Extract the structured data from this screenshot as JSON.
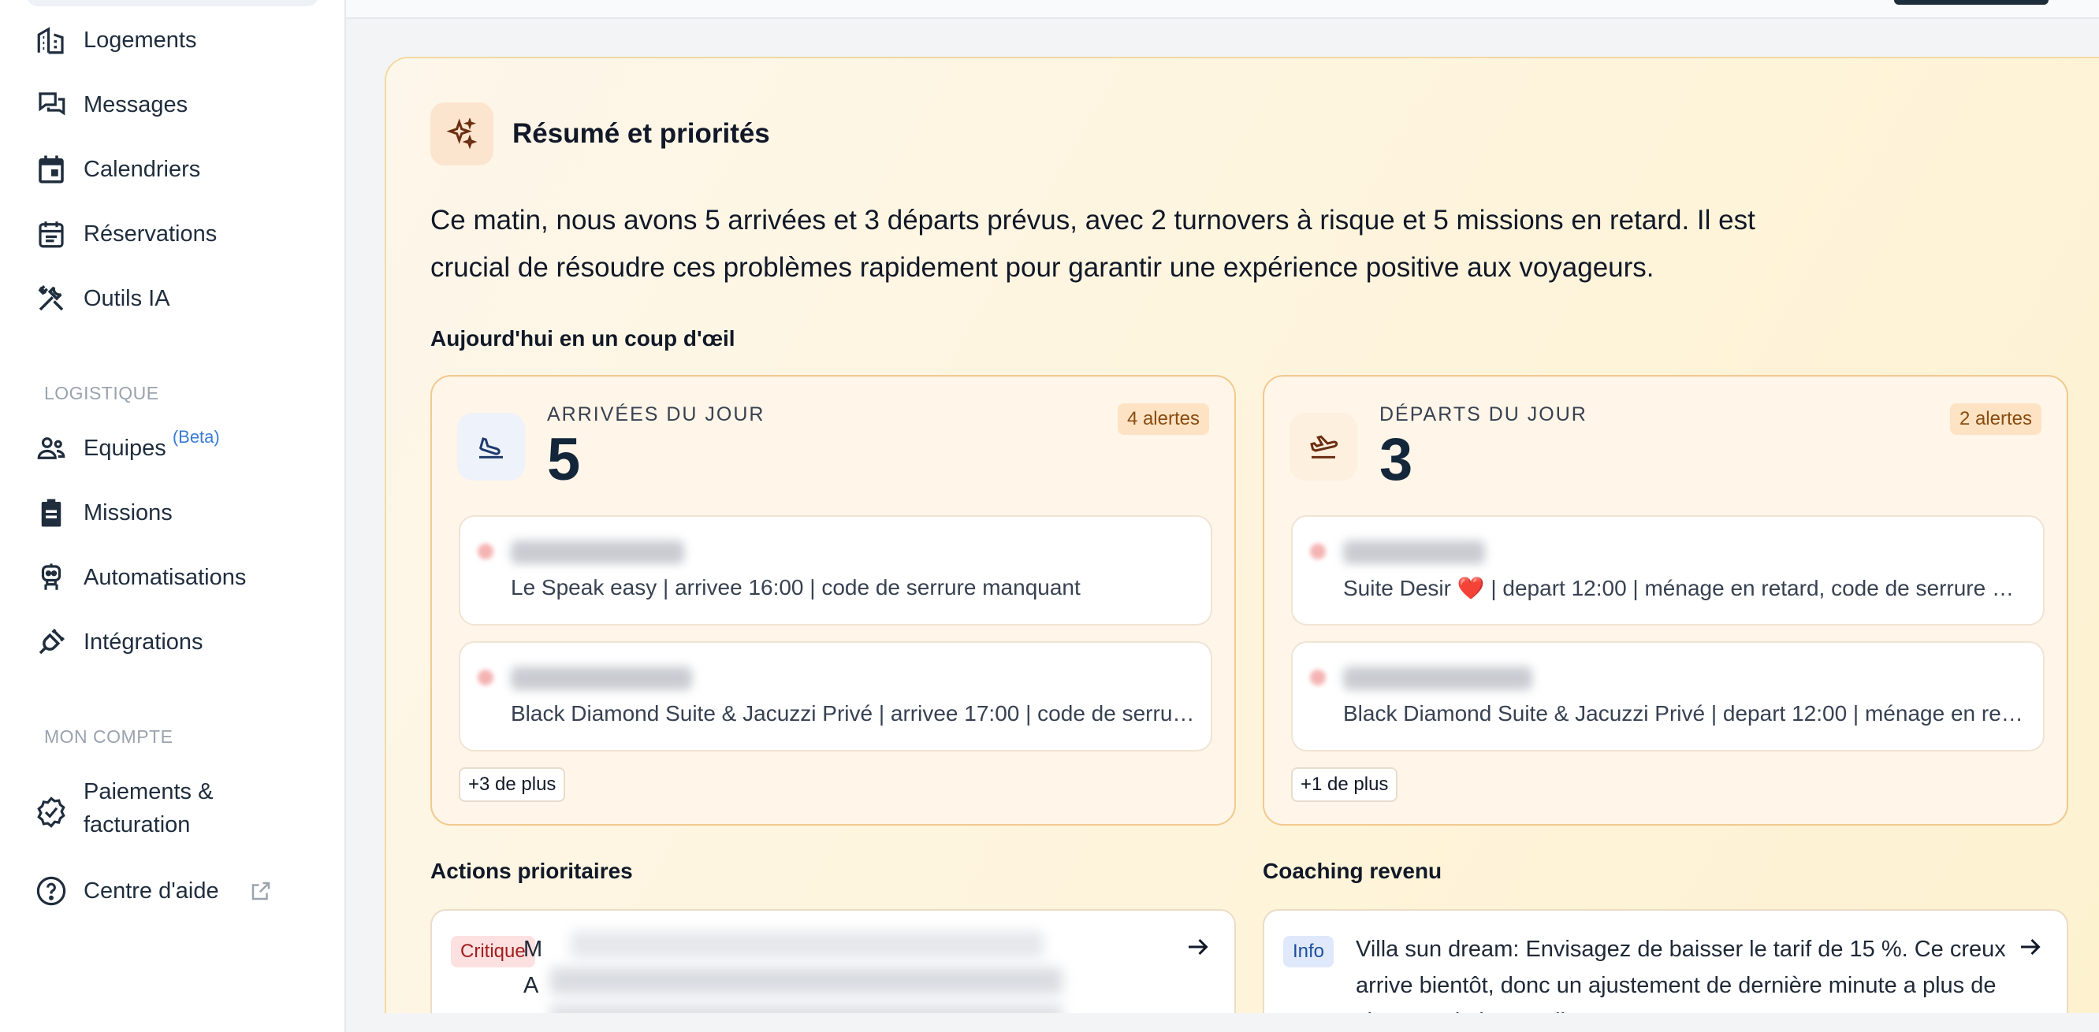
{
  "sidebar": {
    "items": [
      {
        "label": "Logements",
        "icon": "building-icon"
      },
      {
        "label": "Messages",
        "icon": "chat-bubbles-icon"
      },
      {
        "label": "Calendriers",
        "icon": "calendar-icon"
      },
      {
        "label": "Réservations",
        "icon": "calendar-list-icon"
      },
      {
        "label": "Outils IA",
        "icon": "tools-icon"
      }
    ],
    "section_logistique": "LOGISTIQUE",
    "logistique_items": [
      {
        "label": "Equipes",
        "badge": "(Beta)",
        "icon": "team-icon"
      },
      {
        "label": "Missions",
        "icon": "clipboard-icon"
      },
      {
        "label": "Automatisations",
        "icon": "robot-icon"
      },
      {
        "label": "Intégrations",
        "icon": "plug-icon"
      }
    ],
    "section_compte": "MON COMPTE",
    "compte_items": [
      {
        "label_line1": "Paiements &",
        "label_line2": "facturation",
        "icon": "verified-badge-icon"
      },
      {
        "label": "Centre d'aide",
        "icon": "help-circle-icon",
        "trailing_icon": "external-link-icon"
      }
    ]
  },
  "summary": {
    "title": "Résumé et priorités",
    "text": "Ce matin, nous avons 5 arrivées et 3 départs prévus, avec 2 turnovers à risque et 5 missions en retard. Il est crucial de résoudre ces problèmes rapidement pour garantir une expérience positive aux voyageurs.",
    "glance_title": "Aujourd'hui en un coup d'œil"
  },
  "arrivals": {
    "label": "ARRIVÉES DU JOUR",
    "count": "5",
    "alerts": "4 alertes",
    "entries": [
      "Le Speak easy | arrivee 16:00 | code de serrure manquant",
      "Black Diamond Suite & Jacuzzi Privé | arrivee 17:00 | code de serrure manquant"
    ],
    "more": "+3 de plus"
  },
  "departures": {
    "label": "DÉPARTS DU JOUR",
    "count": "3",
    "alerts": "2 alertes",
    "entries": [
      "Suite Desir ❤️ | depart 12:00 | ménage en retard, code de serrure manquant",
      "Black Diamond Suite & Jacuzzi Privé | depart 12:00 | ménage en retard"
    ],
    "more": "+1 de plus"
  },
  "actions": {
    "title": "Actions prioritaires",
    "tag": "Critique",
    "text_start": "M",
    "text_line2": "A"
  },
  "coaching": {
    "title": "Coaching revenu",
    "tag": "Info",
    "text": "Villa sun dream: Envisagez de baisser le tarif de 15 %. Ce creux arrive bientôt, donc un ajustement de dernière minute a plus de chances de le remplir."
  },
  "colors": {
    "accent_dark": "#13263a",
    "alert_orange": "#8a4b10",
    "critical_red": "#a01f1f",
    "info_blue": "#1d4d9c"
  }
}
